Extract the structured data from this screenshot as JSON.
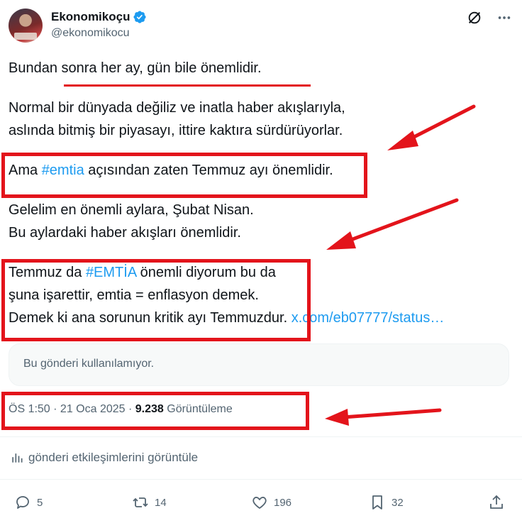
{
  "author": {
    "name": "Ekonomikoçu",
    "handle": "@ekonomikocu",
    "verified": true
  },
  "tweet": {
    "p1": "Bundan sonra her ay, gün bile önemlidir.",
    "p2_l1": "Normal bir dünyada değiliz ve inatla haber akışlarıyla,",
    "p2_l2": "aslında bitmiş bir piyasayı, ittire kaktıra sürdürüyorlar.",
    "p3_pre": "Ama ",
    "p3_tag": "#emtia",
    "p3_post": " açısından zaten Temmuz ayı önemlidir.",
    "p4_l1": "Gelelim en önemli aylara, Şubat Nisan.",
    "p4_l2": "Bu aylardaki haber akışları önemlidir.",
    "p5_l1_pre": "Temmuz da ",
    "p5_l1_tag": "#EMTİA",
    "p5_l1_post": " önemli diyorum bu da",
    "p5_l2": "şuna işarettir, emtia = enflasyon demek.",
    "p5_l3": "Demek ki ana sorunun kritik ayı Temmuzdur.",
    "link_text": "x.com/eb07777/status…"
  },
  "unavailable_text": "Bu gönderi kullanılamıyor.",
  "meta": {
    "time_date": "ÖS 1:50 · 21 Oca 2025 · ",
    "views_count": "9.238",
    "views_label": " Görüntüleme"
  },
  "analytics_label": "gönderi etkileşimlerini görüntüle",
  "actions": {
    "replies": "5",
    "reposts": "14",
    "likes": "196",
    "bookmarks": "32"
  },
  "colors": {
    "annotation_red": "#e3141b",
    "link_blue": "#1d9bf0",
    "verified_blue": "#1d9bf0",
    "secondary_text": "#536471"
  },
  "icons": [
    "verified-badge-icon",
    "grok-icon",
    "more-icon",
    "analytics-icon",
    "reply-icon",
    "repost-icon",
    "like-icon",
    "bookmark-icon",
    "share-icon"
  ]
}
